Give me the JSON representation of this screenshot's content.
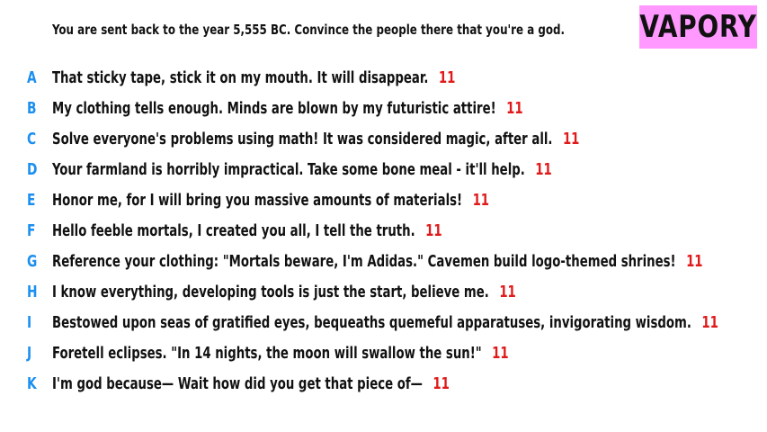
{
  "prompt": "You are sent back to the year 5,555 BC. Convince the people there that you're a god.",
  "logo": "VAPORY",
  "colors": {
    "letter": "#1b8ff0",
    "count": "#e01a1a",
    "logo_bg": "#ff99ff"
  },
  "answers": [
    {
      "letter": "A",
      "text": "That sticky tape, stick it on my mouth. It will disappear.",
      "count": "11"
    },
    {
      "letter": "B",
      "text": "My clothing tells enough. Minds are blown by my futuristic attire!",
      "count": "11"
    },
    {
      "letter": "C",
      "text": "Solve everyone's problems using math! It was considered magic, after all.",
      "count": "11"
    },
    {
      "letter": "D",
      "text": "Your farmland is horribly impractical. Take some bone meal - it'll help.",
      "count": "11"
    },
    {
      "letter": "E",
      "text": "Honor me, for I will bring you massive amounts of materials!",
      "count": "11"
    },
    {
      "letter": "F",
      "text": "Hello feeble mortals, I created you all, I tell the truth.",
      "count": "11"
    },
    {
      "letter": "G",
      "text": "Reference your clothing: \"Mortals beware, I'm Adidas.\" Cavemen build logo-themed shrines!",
      "count": "11"
    },
    {
      "letter": "H",
      "text": "I know everything, developing tools is just the start, believe me.",
      "count": "11"
    },
    {
      "letter": "I",
      "text": "Bestowed upon seas of gratified eyes, bequeaths quemeful apparatuses, invigorating wisdom.",
      "count": "11"
    },
    {
      "letter": "J",
      "text": "Foretell eclipses. \"In 14 nights, the moon will swallow the sun!\"",
      "count": "11"
    },
    {
      "letter": "K",
      "text": "I'm god because— Wait how did you get that piece of—",
      "count": "11"
    }
  ]
}
